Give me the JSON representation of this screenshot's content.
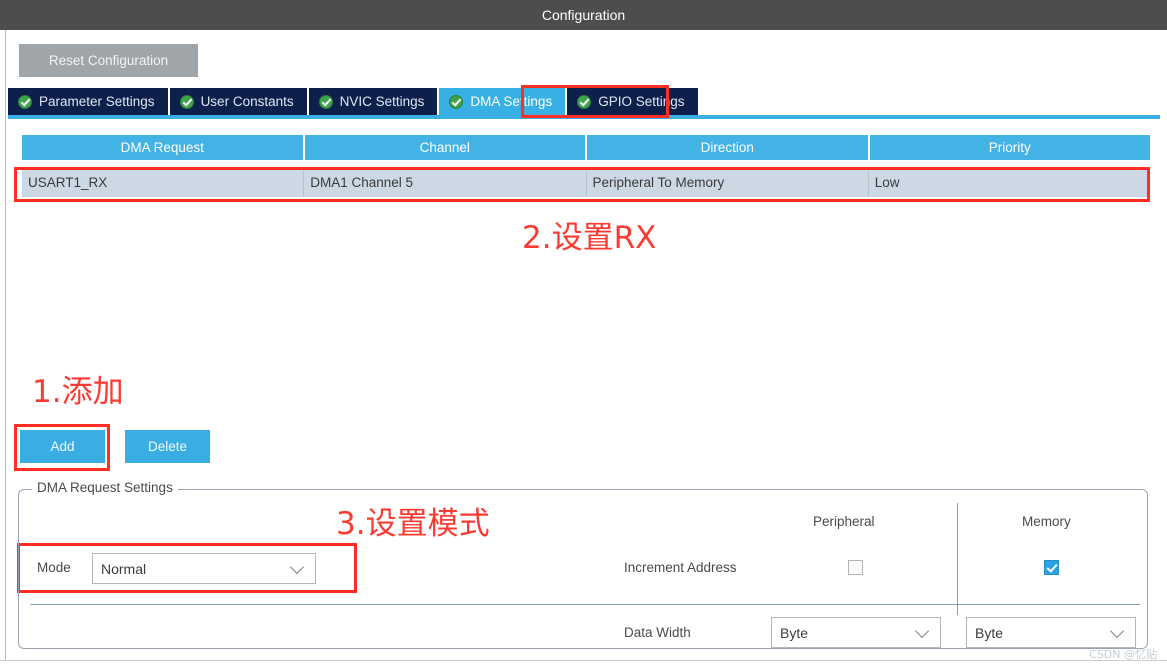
{
  "window": {
    "title": "Configuration"
  },
  "toolbar": {
    "reset_label": "Reset Configuration"
  },
  "tabs": [
    {
      "label": "Parameter Settings",
      "icon": "green-check-icon",
      "active": false
    },
    {
      "label": "User Constants",
      "icon": "green-check-icon",
      "active": false
    },
    {
      "label": "NVIC Settings",
      "icon": "green-check-icon",
      "active": false
    },
    {
      "label": "DMA Settings",
      "icon": "green-check-icon",
      "active": true
    },
    {
      "label": "GPIO Settings",
      "icon": "green-check-icon",
      "active": false
    }
  ],
  "table": {
    "headers": [
      "DMA Request",
      "Channel",
      "Direction",
      "Priority"
    ],
    "rows": [
      {
        "dma_request": "USART1_RX",
        "channel": "DMA1 Channel 5",
        "direction": "Peripheral To Memory",
        "priority": "Low",
        "selected": true
      }
    ]
  },
  "actions": {
    "add_label": "Add",
    "delete_label": "Delete"
  },
  "group": {
    "title": "DMA Request Settings",
    "mode_label": "Mode",
    "mode_value": "Normal",
    "column_peripheral": "Peripheral",
    "column_memory": "Memory",
    "increment_address_label": "Increment Address",
    "increment_peripheral_checked": "false",
    "increment_memory_checked": "true",
    "data_width_label": "Data Width",
    "data_width_peripheral": "Byte",
    "data_width_memory": "Byte"
  },
  "annotations": [
    {
      "id": "step1",
      "text": "1.添加"
    },
    {
      "id": "step2",
      "text": "2.设置RX"
    },
    {
      "id": "step3",
      "text": "3.设置模式"
    }
  ],
  "watermark": "CSDN @忆贴",
  "colors": {
    "titlebar": "#4d4d4d",
    "tab_inactive": "#0d1f4b",
    "tab_active": "#38b0e3",
    "table_header": "#43b2e5",
    "row_selected": "#ccd8e4",
    "accent_blue": "#3aaee2",
    "annotation_red": "#fb3b31",
    "reset_button": "#a0a5a9"
  }
}
